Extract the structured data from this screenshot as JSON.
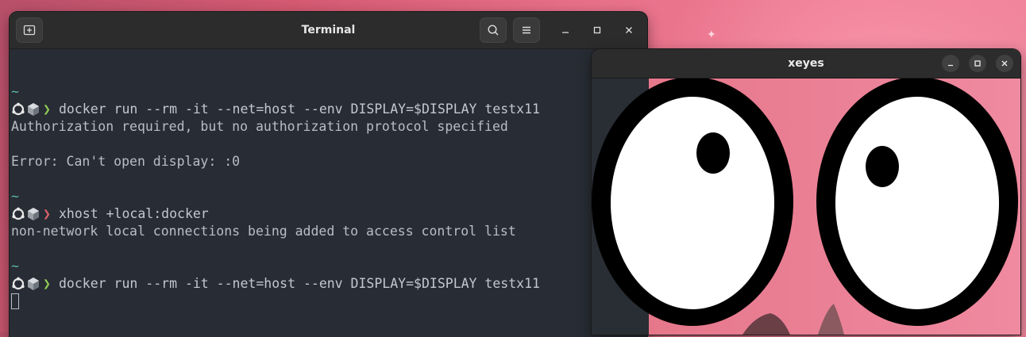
{
  "terminal": {
    "title": "Terminal",
    "lines": [
      {
        "kind": "blank"
      },
      {
        "kind": "tilde",
        "text": "~"
      },
      {
        "kind": "prompt",
        "status": "ok",
        "arrow": "❯",
        "command": "docker run --rm -it --net=host --env DISPLAY=$DISPLAY testx11"
      },
      {
        "kind": "output",
        "text": "Authorization required, but no authorization protocol specified"
      },
      {
        "kind": "blank"
      },
      {
        "kind": "output",
        "text": "Error: Can't open display: :0"
      },
      {
        "kind": "blank"
      },
      {
        "kind": "tilde",
        "text": "~"
      },
      {
        "kind": "prompt",
        "status": "err",
        "arrow": "❯",
        "command": "xhost +local:docker"
      },
      {
        "kind": "output",
        "text": "non-network local connections being added to access control list"
      },
      {
        "kind": "blank"
      },
      {
        "kind": "tilde",
        "text": "~"
      },
      {
        "kind": "prompt",
        "status": "ok",
        "arrow": "❯",
        "command": "docker run --rm -it --net=host --env DISPLAY=$DISPLAY testx11"
      },
      {
        "kind": "cursor"
      }
    ],
    "colors": {
      "background": "#282c34",
      "prompt_ok": "#8fcc55",
      "prompt_err": "#e0606a",
      "tilde": "#5bb8a8"
    }
  },
  "xeyes": {
    "title": "xeyes"
  },
  "icons": {
    "new_tab": "new-tab-icon",
    "search": "search-icon",
    "menu": "hamburger-menu-icon",
    "minimize": "minimize-icon",
    "maximize": "maximize-icon",
    "close": "close-icon",
    "distro": "ubuntu-logo-icon",
    "container": "container-cube-icon"
  }
}
